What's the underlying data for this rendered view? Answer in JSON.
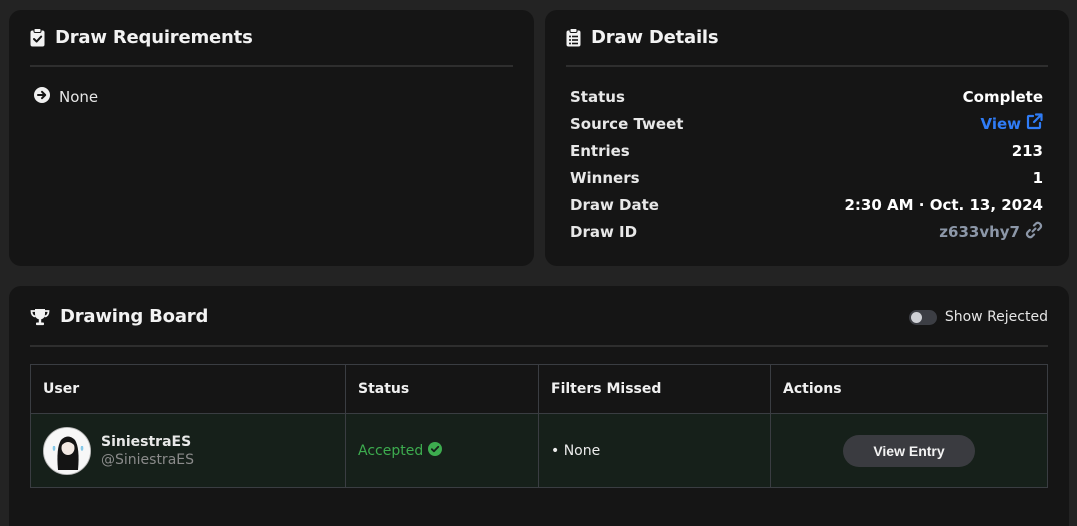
{
  "requirements": {
    "title": "Draw Requirements",
    "items": [
      "None"
    ]
  },
  "details": {
    "title": "Draw Details",
    "rows": [
      {
        "label": "Status",
        "value": "Complete"
      },
      {
        "label": "Source Tweet",
        "value": "View"
      },
      {
        "label": "Entries",
        "value": "213"
      },
      {
        "label": "Winners",
        "value": "1"
      },
      {
        "label": "Draw Date",
        "value": "2:30 AM · Oct. 13, 2024"
      },
      {
        "label": "Draw ID",
        "value": "z633vhy7"
      }
    ]
  },
  "board": {
    "title": "Drawing Board",
    "toggle_label": "Show Rejected",
    "toggle_on": false,
    "columns": [
      "User",
      "Status",
      "Filters Missed",
      "Actions"
    ],
    "rows": [
      {
        "name": "SiniestraES",
        "handle": "@SiniestraES",
        "status": "Accepted",
        "filters_missed": "• None",
        "action_label": "View Entry"
      }
    ]
  },
  "colors": {
    "accent_blue": "#2f7cf6",
    "accepted_green": "#3dac4f",
    "card_bg": "#151515",
    "page_bg": "#232323"
  },
  "icons": {
    "requirements": "clipboard-check-icon",
    "details": "clipboard-list-icon",
    "board": "trophy-icon",
    "requirement_item": "circle-arrow-right-icon",
    "source_tweet": "external-link-icon",
    "draw_id": "link-icon",
    "accepted": "check-circle-icon"
  }
}
